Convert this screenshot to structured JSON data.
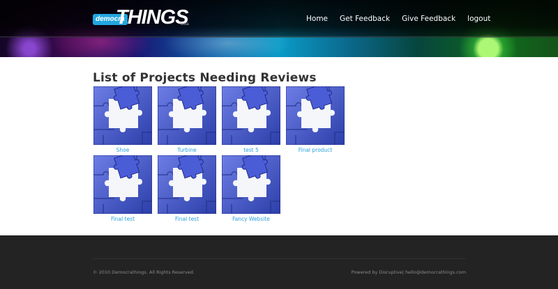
{
  "logo": {
    "prefix": "democra",
    "wordmark": "THINGS",
    "tag": "beta"
  },
  "nav": {
    "items": [
      {
        "label": "Home"
      },
      {
        "label": "Get Feedback"
      },
      {
        "label": "Give Feedback"
      },
      {
        "label": "logout"
      }
    ]
  },
  "main": {
    "title": "List of Projects Needing Reviews",
    "thumbnail_icon": "puzzle-piece-icon",
    "projects": [
      {
        "label": "Shoe"
      },
      {
        "label": "Turbine"
      },
      {
        "label": "test 5"
      },
      {
        "label": "Final product"
      },
      {
        "label": "Final test"
      },
      {
        "label": "Final test"
      },
      {
        "label": "Fancy Website"
      }
    ]
  },
  "footer": {
    "copyright": "© 2010 Democrathings. All Rights Reserved.",
    "powered_by": "Powered by Disruptive",
    "separator": "|",
    "email": "hello@democrathings.com"
  },
  "colors": {
    "link": "#2aa2dc",
    "footer_bg": "#232323",
    "puzzle_blue": "#3d50c8"
  }
}
